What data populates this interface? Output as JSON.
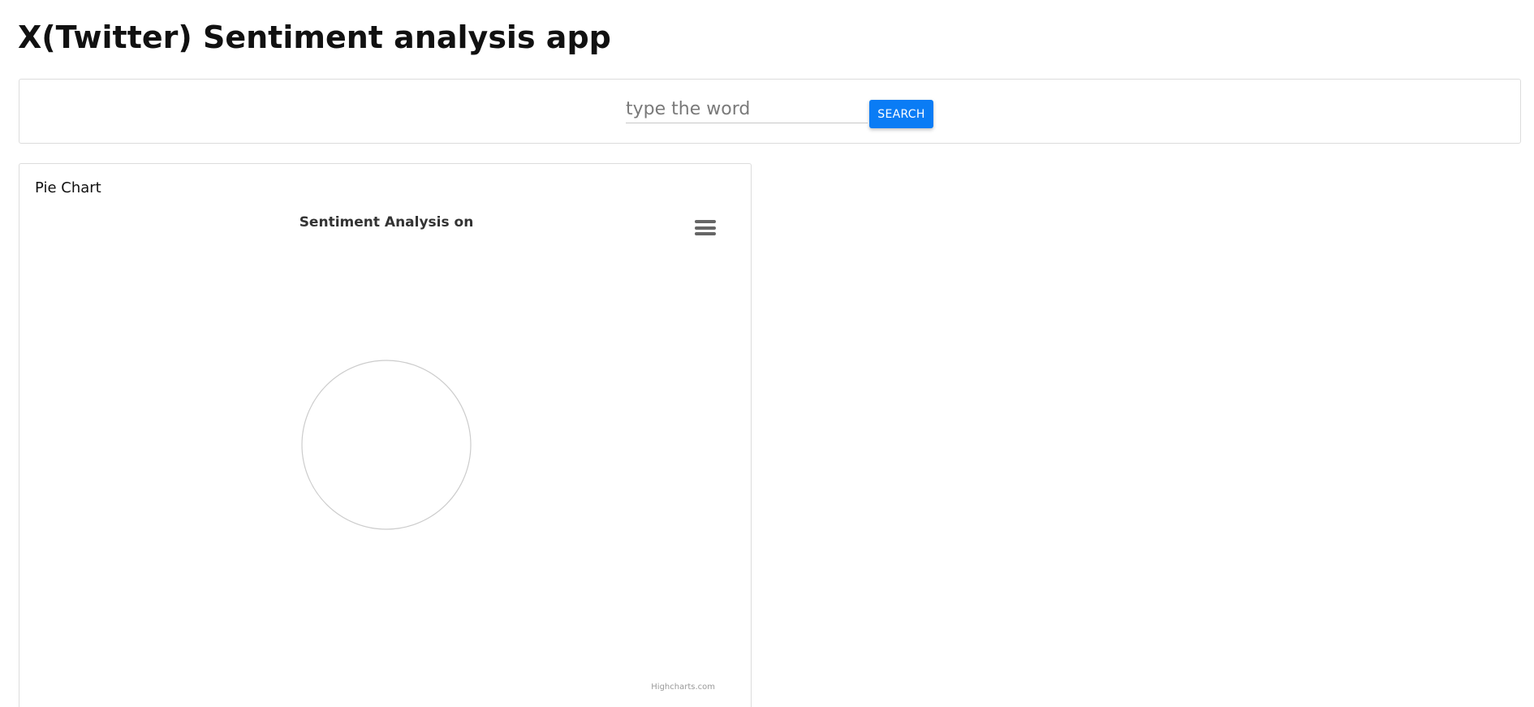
{
  "app": {
    "title": "X(Twitter) Sentiment analysis app"
  },
  "search": {
    "placeholder": "type the word",
    "value": "",
    "button_label": "SEARCH"
  },
  "pie_card": {
    "title": "Pie Chart"
  },
  "chart_data": {
    "type": "pie",
    "title": "Sentiment Analysis on",
    "slices": [],
    "credits": "Highcharts.com",
    "menu_icon": "hamburger-menu-icon"
  },
  "colors": {
    "accent": "#0a7cf5",
    "empty_pie_outline": "#cccccc"
  }
}
